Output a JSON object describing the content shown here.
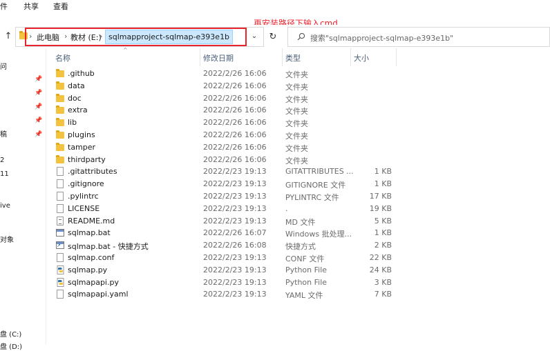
{
  "menubar": {
    "items": [
      "件",
      "共享",
      "查看"
    ]
  },
  "annotation": "再安装路径下输入cmd",
  "address": {
    "crumbs": [
      "此电脑",
      "教材 (E:)"
    ],
    "current": "sqlmapproject-sqlmap-e393e1b"
  },
  "search": {
    "placeholder": "搜索\"sqlmapproject-sqlmap-e393e1b\""
  },
  "columns": {
    "name": "名称",
    "date": "修改日期",
    "type": "类型",
    "size": "大小"
  },
  "sidebar": {
    "labels": [
      "问",
      "稿",
      "2",
      "11",
      "ive",
      "对象",
      "盘 (C:)",
      "盘 (D:)"
    ]
  },
  "files": [
    {
      "name": ".github",
      "date": "2022/2/26 16:06",
      "type": "文件夹",
      "size": "",
      "icon": "folder"
    },
    {
      "name": "data",
      "date": "2022/2/26 16:06",
      "type": "文件夹",
      "size": "",
      "icon": "folder"
    },
    {
      "name": "doc",
      "date": "2022/2/26 16:06",
      "type": "文件夹",
      "size": "",
      "icon": "folder"
    },
    {
      "name": "extra",
      "date": "2022/2/26 16:06",
      "type": "文件夹",
      "size": "",
      "icon": "folder"
    },
    {
      "name": "lib",
      "date": "2022/2/26 16:06",
      "type": "文件夹",
      "size": "",
      "icon": "folder"
    },
    {
      "name": "plugins",
      "date": "2022/2/26 16:06",
      "type": "文件夹",
      "size": "",
      "icon": "folder"
    },
    {
      "name": "tamper",
      "date": "2022/2/26 16:06",
      "type": "文件夹",
      "size": "",
      "icon": "folder"
    },
    {
      "name": "thirdparty",
      "date": "2022/2/26 16:06",
      "type": "文件夹",
      "size": "",
      "icon": "folder"
    },
    {
      "name": ".gitattributes",
      "date": "2022/2/23 19:13",
      "type": "GITATTRIBUTES ...",
      "size": "1 KB",
      "icon": "file"
    },
    {
      "name": ".gitignore",
      "date": "2022/2/23 19:13",
      "type": "GITIGNORE 文件",
      "size": "1 KB",
      "icon": "file"
    },
    {
      "name": ".pylintrc",
      "date": "2022/2/23 19:13",
      "type": "PYLINTRC 文件",
      "size": "17 KB",
      "icon": "file"
    },
    {
      "name": "LICENSE",
      "date": "2022/2/23 19:13",
      "type": ".",
      "size": "19 KB",
      "icon": "file"
    },
    {
      "name": "README.md",
      "date": "2022/2/23 19:13",
      "type": "MD 文件",
      "size": "5 KB",
      "icon": "text"
    },
    {
      "name": "sqlmap.bat",
      "date": "2022/2/26 16:07",
      "type": "Windows 批处理...",
      "size": "1 KB",
      "icon": "bat"
    },
    {
      "name": "sqlmap.bat - 快捷方式",
      "date": "2022/2/26 16:08",
      "type": "快捷方式",
      "size": "2 KB",
      "icon": "shortcut"
    },
    {
      "name": "sqlmap.conf",
      "date": "2022/2/23 19:13",
      "type": "CONF 文件",
      "size": "22 KB",
      "icon": "file"
    },
    {
      "name": "sqlmap.py",
      "date": "2022/2/23 19:13",
      "type": "Python File",
      "size": "24 KB",
      "icon": "python"
    },
    {
      "name": "sqlmapapi.py",
      "date": "2022/2/23 19:13",
      "type": "Python File",
      "size": "3 KB",
      "icon": "python"
    },
    {
      "name": "sqlmapapi.yaml",
      "date": "2022/2/23 19:13",
      "type": "YAML 文件",
      "size": "7 KB",
      "icon": "file"
    }
  ]
}
